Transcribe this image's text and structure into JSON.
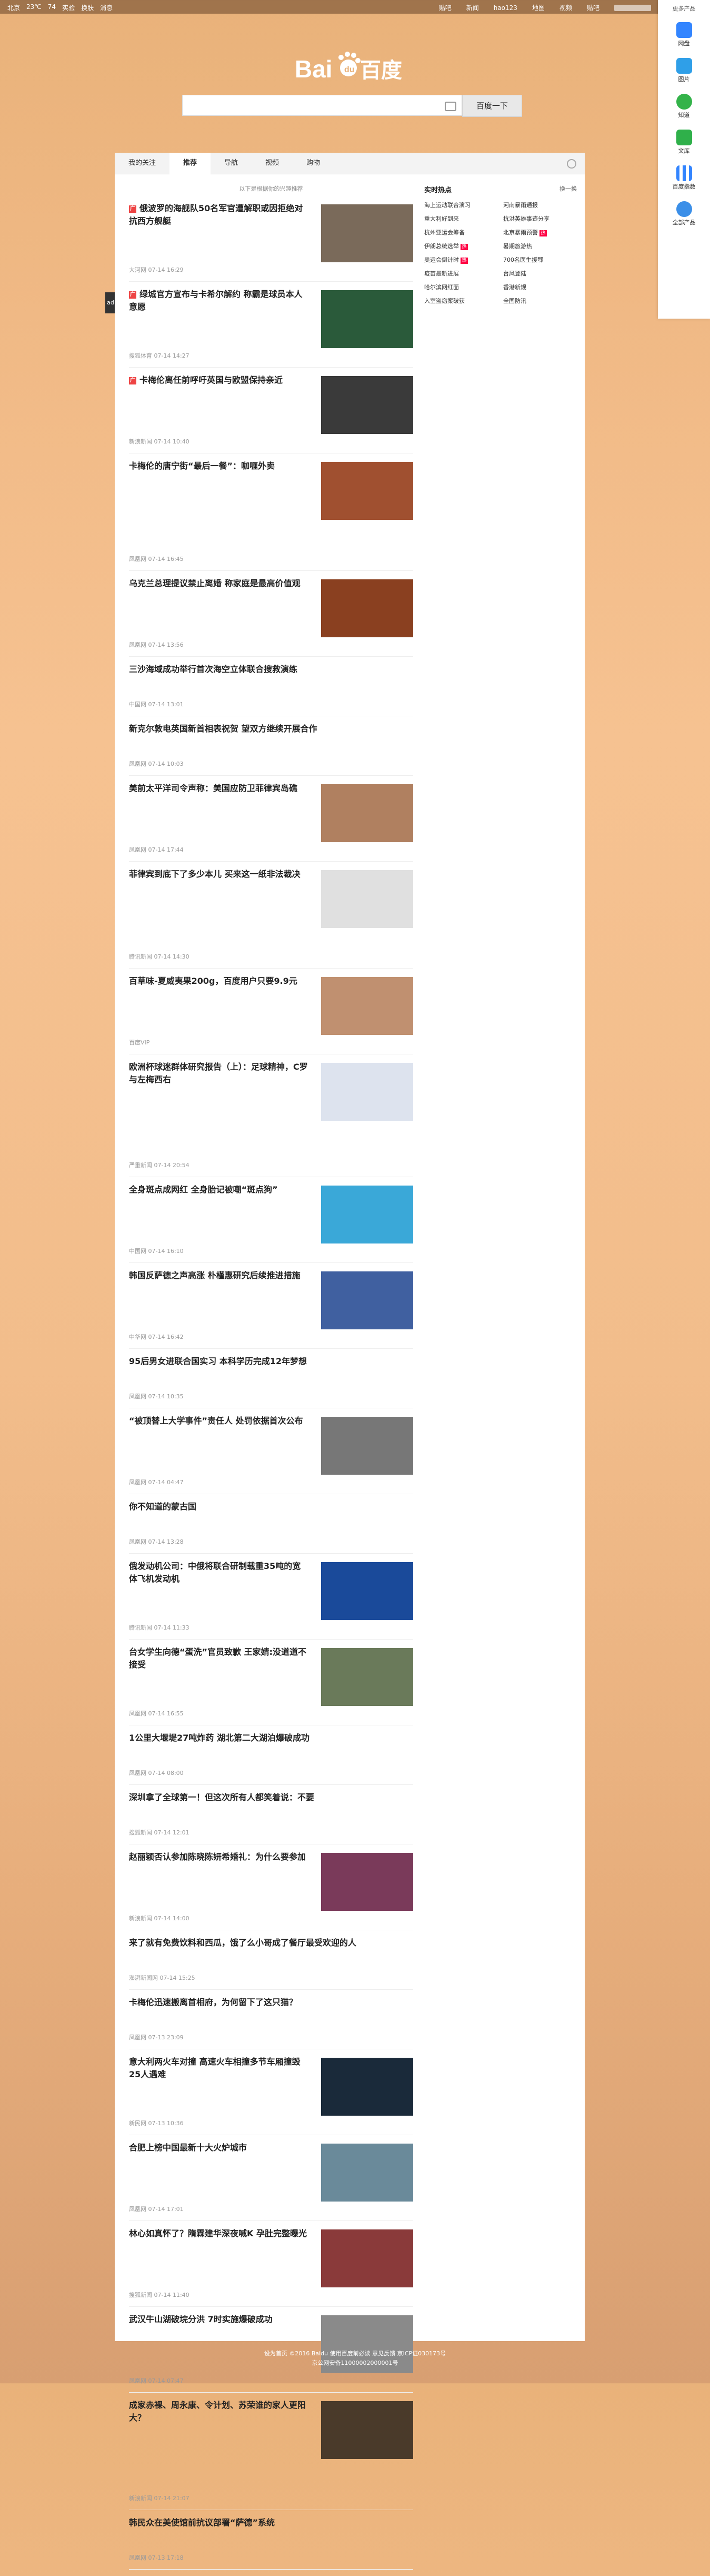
{
  "topbar": {
    "left": [
      "北京",
      "23℃",
      "74",
      "实验",
      "换肤",
      "消息"
    ],
    "right": [
      "贴吧",
      "新闻",
      "hao123",
      "地图",
      "视频",
      "贴吧",
      "更多"
    ]
  },
  "rail": {
    "head": "更多产品",
    "items": [
      "网盘",
      "图片",
      "知道",
      "文库",
      "百度指数",
      "全部产品"
    ]
  },
  "search": {
    "placeholder": "",
    "button": "百度一下"
  },
  "tabs": [
    "我的关注",
    "推荐",
    "导航",
    "视频",
    "购物"
  ],
  "feed_tip": "以下是根据你的兴趣推荐",
  "hot": {
    "title": "实时热点",
    "refresh": "换一换",
    "items": [
      "海上运动联合演习",
      "河南暴雨通报",
      "重大利好到来",
      "抗洪英雄事迹分享",
      "杭州亚运会筹备",
      "北京暴雨预警",
      "伊朗总统选举",
      "暑期旅游热",
      "奥运会倒计时",
      "700名医生援鄂",
      "疫苗最新进展",
      "台风登陆",
      "哈尔滨网红面",
      "香港新规",
      "入室盗窃案破获",
      "全国防汛"
    ]
  },
  "news": [
    {
      "title": "俄波罗的海舰队50名军官遭解职或因拒绝对抗西方舰艇",
      "meta": "大河网  07-14 16:29",
      "ad": true
    },
    {
      "title": "绿城官方宣布与卡希尔解约 称霸是球员本人意愿",
      "meta": "搜狐体育  07-14 14:27",
      "ad": true
    },
    {
      "title": "卡梅伦离任前呼吁英国与欧盟保持亲近",
      "meta": "新浪新闻  07-14 10:40",
      "ad": true
    },
    {
      "title": "卡梅伦的唐宁街“最后一餐”：咖喱外卖",
      "meta": "凤凰网  07-14 16:45",
      "ad": false
    },
    {
      "title": "乌克兰总理提议禁止离婚 称家庭是最高价值观",
      "meta": "凤凰网  07-14 13:56",
      "ad": false
    },
    {
      "title": "三沙海域成功举行首次海空立体联合搜救演练",
      "meta": "中国网  07-14 13:01",
      "ad": false
    },
    {
      "title": "新克尔敦电英国新首相表祝贺 望双方继续开展合作",
      "meta": "凤凰网  07-14 10:03",
      "ad": false
    },
    {
      "title": "美前太平洋司令声称：美国应防卫菲律宾岛礁",
      "meta": "凤凰网  07-14 17:44",
      "ad": false
    },
    {
      "title": "菲律宾到底下了多少本儿 买来这一纸非法裁决",
      "meta": "腾讯新闻  07-14 14:30",
      "ad": false
    },
    {
      "title": "百草味-夏威夷果200g，百度用户只要9.9元",
      "meta": "百度VIP",
      "ad": false
    },
    {
      "title": "欧洲杯球迷群体研究报告（上）：足球精神，C罗与左梅西右",
      "meta": "严重新闻  07-14 20:54",
      "ad": false
    },
    {
      "title": "全身斑点成网红 全身胎记被嘲“斑点狗”",
      "meta": "中国网  07-14 16:10",
      "ad": false
    },
    {
      "title": "韩国反萨德之声高涨 朴槿惠研究后续推进措施",
      "meta": "中华网  07-14 16:42",
      "ad": false
    },
    {
      "title": "95后男女进联合国实习 本科学历完成12年梦想",
      "meta": "凤凰网  07-14 10:35",
      "ad": false
    },
    {
      "title": "“被顶替上大学事件”责任人 处罚依据首次公布",
      "meta": "凤凰网  07-14 04:47",
      "ad": false
    },
    {
      "title": "你不知道的蒙古国",
      "meta": "凤凰网  07-14 13:28",
      "ad": false
    },
    {
      "title": "俄发动机公司：中俄将联合研制载重35吨的宽体飞机发动机",
      "meta": "腾讯新闻  07-14 11:33",
      "ad": false
    },
    {
      "title": "台女学生向德“蛋洗”官员致歉 王家婧:没道道不接受",
      "meta": "凤凰网  07-14 16:55",
      "ad": false
    },
    {
      "title": "1公里大堰堤27吨炸药 湖北第二大湖泊爆破成功",
      "meta": "凤凰网  07-14 08:00",
      "ad": false
    },
    {
      "title": "深圳拿了全球第一！但这次所有人都笑着说：不要",
      "meta": "搜狐新闻  07-14 12:01",
      "ad": false
    },
    {
      "title": "赵丽颖否认参加陈晓陈妍希婚礼：为什么要参加",
      "meta": "新浪新闻  07-14 14:00",
      "ad": false
    },
    {
      "title": "来了就有免费饮料和西瓜，饿了么小哥成了餐厅最受欢迎的人",
      "meta": "澎湃新闻网  07-14 15:25",
      "ad": false
    },
    {
      "title": "卡梅伦迅速搬离首相府，为何留下了这只猫？",
      "meta": "凤凰网  07-13 23:09",
      "ad": false
    },
    {
      "title": "意大利两火车对撞 高速火车相撞多节车厢撞毁25人遇难",
      "meta": "新民网  07-13 10:36",
      "ad": false
    },
    {
      "title": "合肥上榜中国最新十大火炉城市",
      "meta": "凤凰网  07-14 17:01",
      "ad": false
    },
    {
      "title": "林心如真怀了？隋霖建华深夜喊K 孕肚完整曝光",
      "meta": "搜狐新闻  07-14 11:40",
      "ad": false
    },
    {
      "title": "武汉牛山湖破垸分洪 7时实施爆破成功",
      "meta": "凤凰网  07-14 07:47",
      "ad": false
    },
    {
      "title": "成家赤裸、周永康、令计划、苏荣谁的家人更阳大？",
      "meta": "新浪新闻  07-14 21:07",
      "ad": false
    },
    {
      "title": "韩民众在美使馆前抗议部署“萨德”系统",
      "meta": "凤凰网  07-13 17:18",
      "ad": false
    }
  ],
  "footer": {
    "line1": "设为首页  ©2016 Baidu  使用百度前必读  意见反馈  京ICP证030173号",
    "line2": "京公网安备11000002000001号"
  },
  "colors": {
    "accent": "#3385ff",
    "ad": "#ee4444"
  }
}
